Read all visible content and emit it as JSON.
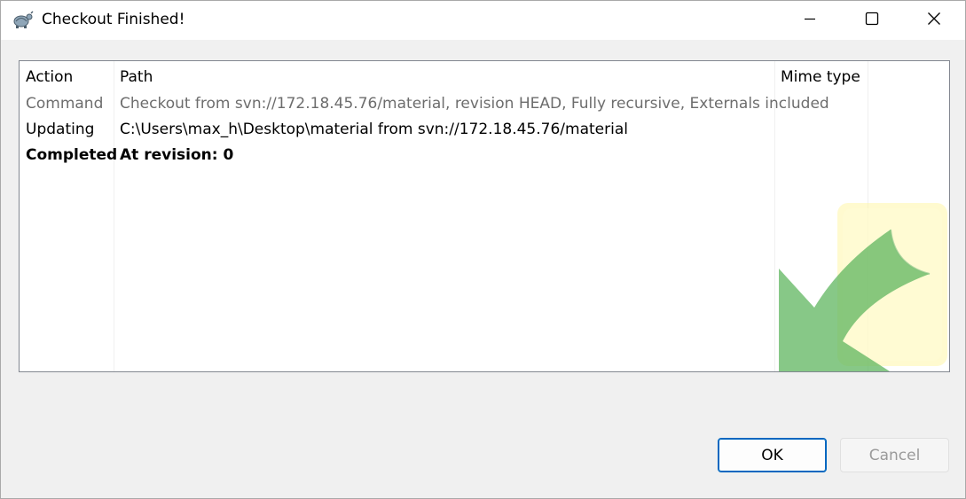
{
  "window": {
    "title": "Checkout Finished!",
    "controls": {
      "minimize": "minimize-icon",
      "maximize": "maximize-icon",
      "close": "close-icon"
    }
  },
  "list": {
    "columns": [
      "Action",
      "Path",
      "Mime type"
    ],
    "rows": [
      {
        "action": "Command",
        "path": "Checkout from svn://172.18.45.76/material, revision HEAD, Fully recursive, Externals included",
        "mime": ""
      },
      {
        "action": "Updating",
        "path": "C:\\Users\\max_h\\Desktop\\material from svn://172.18.45.76/material",
        "mime": ""
      },
      {
        "action": "Completed",
        "path": "At revision: 0",
        "mime": ""
      }
    ]
  },
  "buttons": {
    "ok": "OK",
    "cancel": "Cancel"
  },
  "colors": {
    "accent": "#0067c0",
    "command_text": "#6d6d6d",
    "disabled_text": "#9a9a9a",
    "watermark_arrow": "#2e9a2e",
    "watermark_box": "#fff6a8"
  }
}
